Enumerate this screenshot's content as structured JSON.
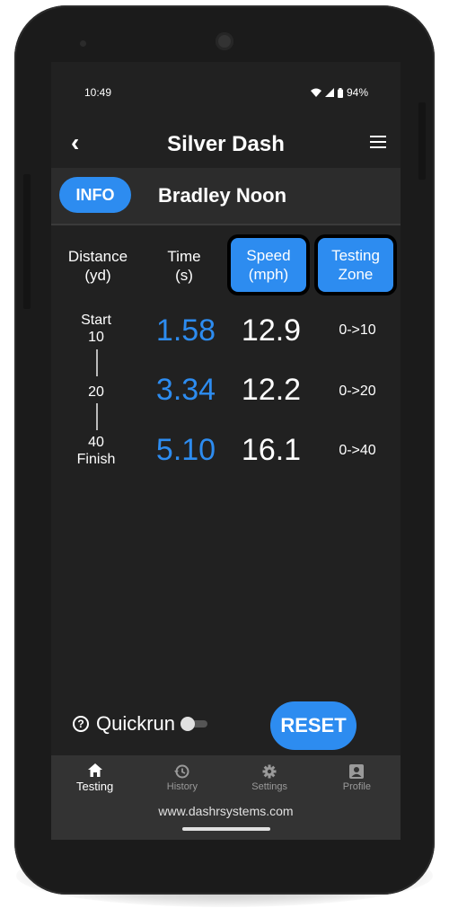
{
  "status": {
    "time": "10:49",
    "battery": "94%"
  },
  "appbar": {
    "title": "Silver Dash"
  },
  "athlete": {
    "info_label": "INFO",
    "name": "Bradley Noon"
  },
  "headers": {
    "distance": [
      "Distance",
      "(yd)"
    ],
    "time": [
      "Time",
      "(s)"
    ],
    "speed": [
      "Speed",
      "(mph)"
    ],
    "zone": [
      "Testing",
      "Zone"
    ]
  },
  "distances": {
    "start": "Start",
    "d10": "10",
    "d20": "20",
    "d40": "40",
    "finish": "Finish"
  },
  "rows": [
    {
      "time": "1.58",
      "speed": "12.9",
      "zone": "0->10"
    },
    {
      "time": "3.34",
      "speed": "12.2",
      "zone": "0->20"
    },
    {
      "time": "5.10",
      "speed": "16.1",
      "zone": "0->40"
    }
  ],
  "controls": {
    "quickrun_label": "Quickrun",
    "quickrun_on": false,
    "reset_label": "RESET"
  },
  "nav": [
    {
      "label": "Testing",
      "icon": "home-icon",
      "active": true
    },
    {
      "label": "History",
      "icon": "history-icon",
      "active": false
    },
    {
      "label": "Settings",
      "icon": "gear-icon",
      "active": false
    },
    {
      "label": "Profile",
      "icon": "profile-icon",
      "active": false
    }
  ],
  "footer": {
    "url": "www.dashrsystems.com"
  },
  "colors": {
    "accent": "#2d8cf0",
    "background": "#212121"
  }
}
